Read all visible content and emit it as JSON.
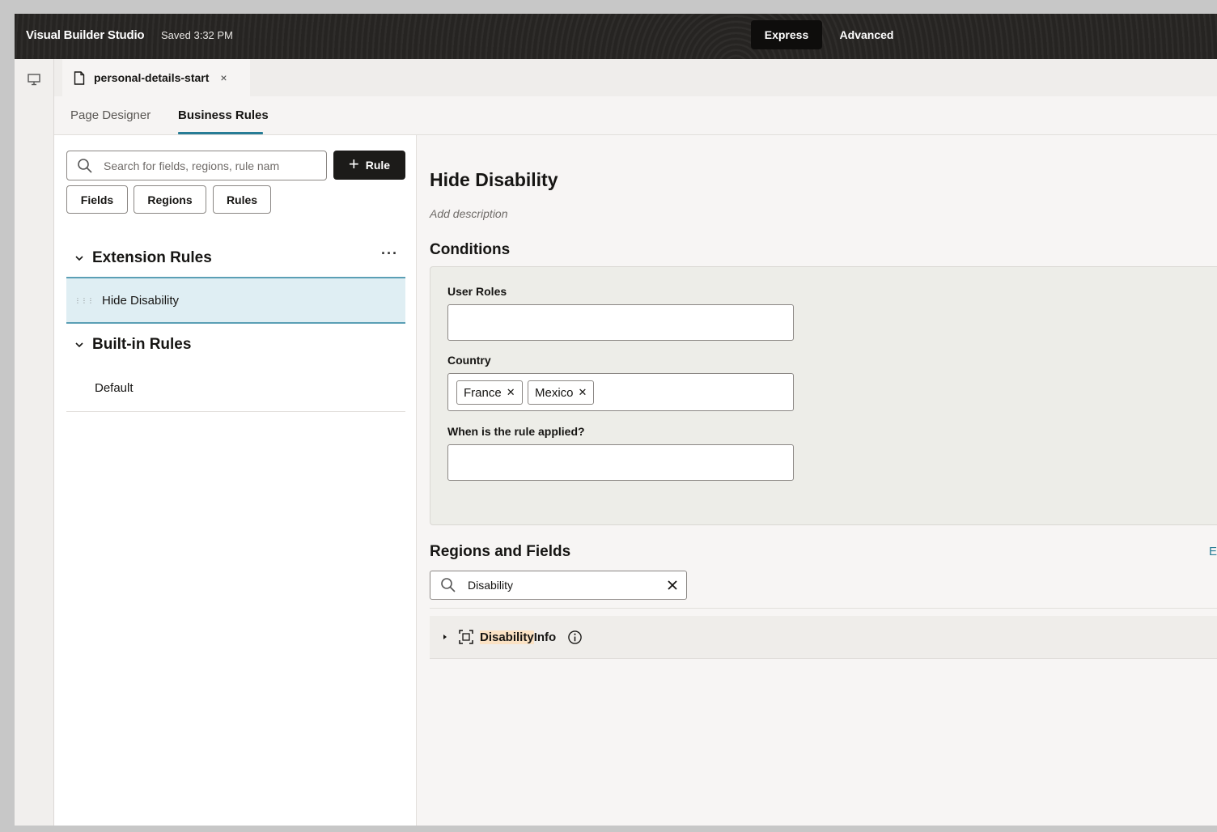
{
  "header": {
    "app_name": "Visual Builder Studio",
    "save_status": "Saved 3:32 PM",
    "modes": {
      "express": "Express",
      "advanced": "Advanced"
    },
    "active_mode": "Express"
  },
  "rail": {
    "icon": "desktop-preview-icon"
  },
  "document_tab": {
    "label": "personal-details-start",
    "close": "×"
  },
  "subtabs": [
    {
      "label": "Page Designer",
      "active": false
    },
    {
      "label": "Business Rules",
      "active": true
    }
  ],
  "left_panel": {
    "search": {
      "placeholder": "Search for fields, regions, rule nam"
    },
    "add_rule_label": "Rule",
    "filters": [
      "Fields",
      "Regions",
      "Rules"
    ],
    "sections": {
      "extension": {
        "title": "Extension Rules",
        "more": "···",
        "items": [
          {
            "label": "Hide Disability",
            "selected": true
          }
        ]
      },
      "builtin": {
        "title": "Built-in Rules",
        "items": [
          {
            "label": "Default"
          }
        ]
      }
    }
  },
  "rule": {
    "title": "Hide Disability",
    "description_placeholder": "Add description",
    "conditions": {
      "title": "Conditions",
      "user_roles_label": "User Roles",
      "country_label": "Country",
      "countries": [
        "France",
        "Mexico"
      ],
      "when_label": "When is the rule applied?"
    },
    "regions": {
      "title": "Regions and Fields",
      "expand_link": "E",
      "search_value": "Disability",
      "tree": [
        {
          "highlight": "Disability",
          "rest": " Info"
        }
      ]
    }
  },
  "colors": {
    "accent": "#277c96",
    "header_bg": "#2a2826",
    "selected_bg": "#dfeef3",
    "highlight": "#fbe2c4"
  }
}
